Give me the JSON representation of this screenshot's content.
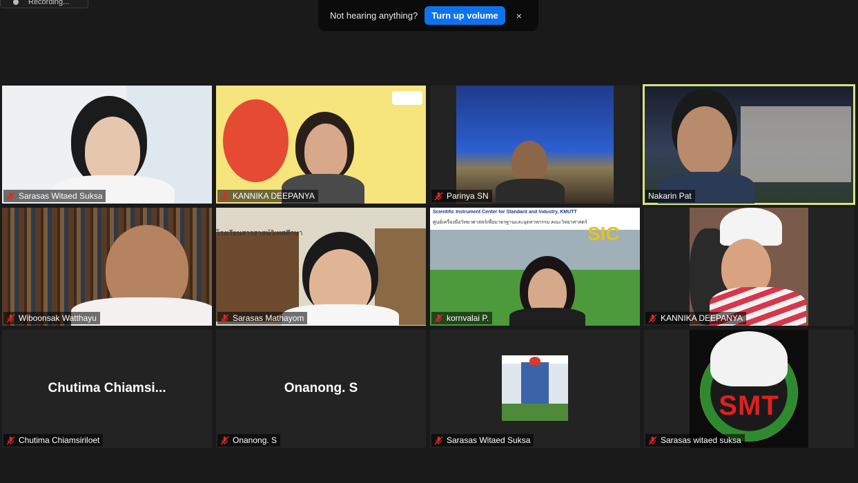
{
  "recording": {
    "label": "Recording..."
  },
  "banner": {
    "message": "Not hearing anything?",
    "button": "Turn up volume",
    "close": "×"
  },
  "tiles": [
    {
      "name": "Sarasas Witaed Suksa"
    },
    {
      "name": "KANNIKA DEEPANYA"
    },
    {
      "name": "Parinya SN"
    },
    {
      "name": "Nakarin Pat"
    },
    {
      "name": "Wiboonsak Watthayu"
    },
    {
      "name": "Sarasas Mathayom"
    },
    {
      "name": "kornvalai P."
    },
    {
      "name": "KANNIKA DEEPANYA"
    },
    {
      "name": "Chutima Chiamsiriloet",
      "display": "Chutima  Chiamsi..."
    },
    {
      "name": "Onanong. S",
      "display": "Onanong. S"
    },
    {
      "name": "Sarasas Witaed Suksa"
    },
    {
      "name": "Sarasas witaed suksa"
    }
  ],
  "overlays": {
    "sic_title": "Scientific Instrument Center for Standard and Industry, KMUTT",
    "sic_subtitle": "ศูนย์เครื่องมือวิทยาศาสตร์เพื่อมาตรฐานและอุตสาหกรรม คณะวิทยาศาสตร์",
    "sic_logo": "SIC",
    "smt_logo": "SMT",
    "school_sign": "โรงเรียนสารสาสน์วิเทศศึกษา"
  },
  "colors": {
    "active_outline": "#d9e37a",
    "button_blue": "#0e72ed",
    "mute_red": "#e02828"
  }
}
